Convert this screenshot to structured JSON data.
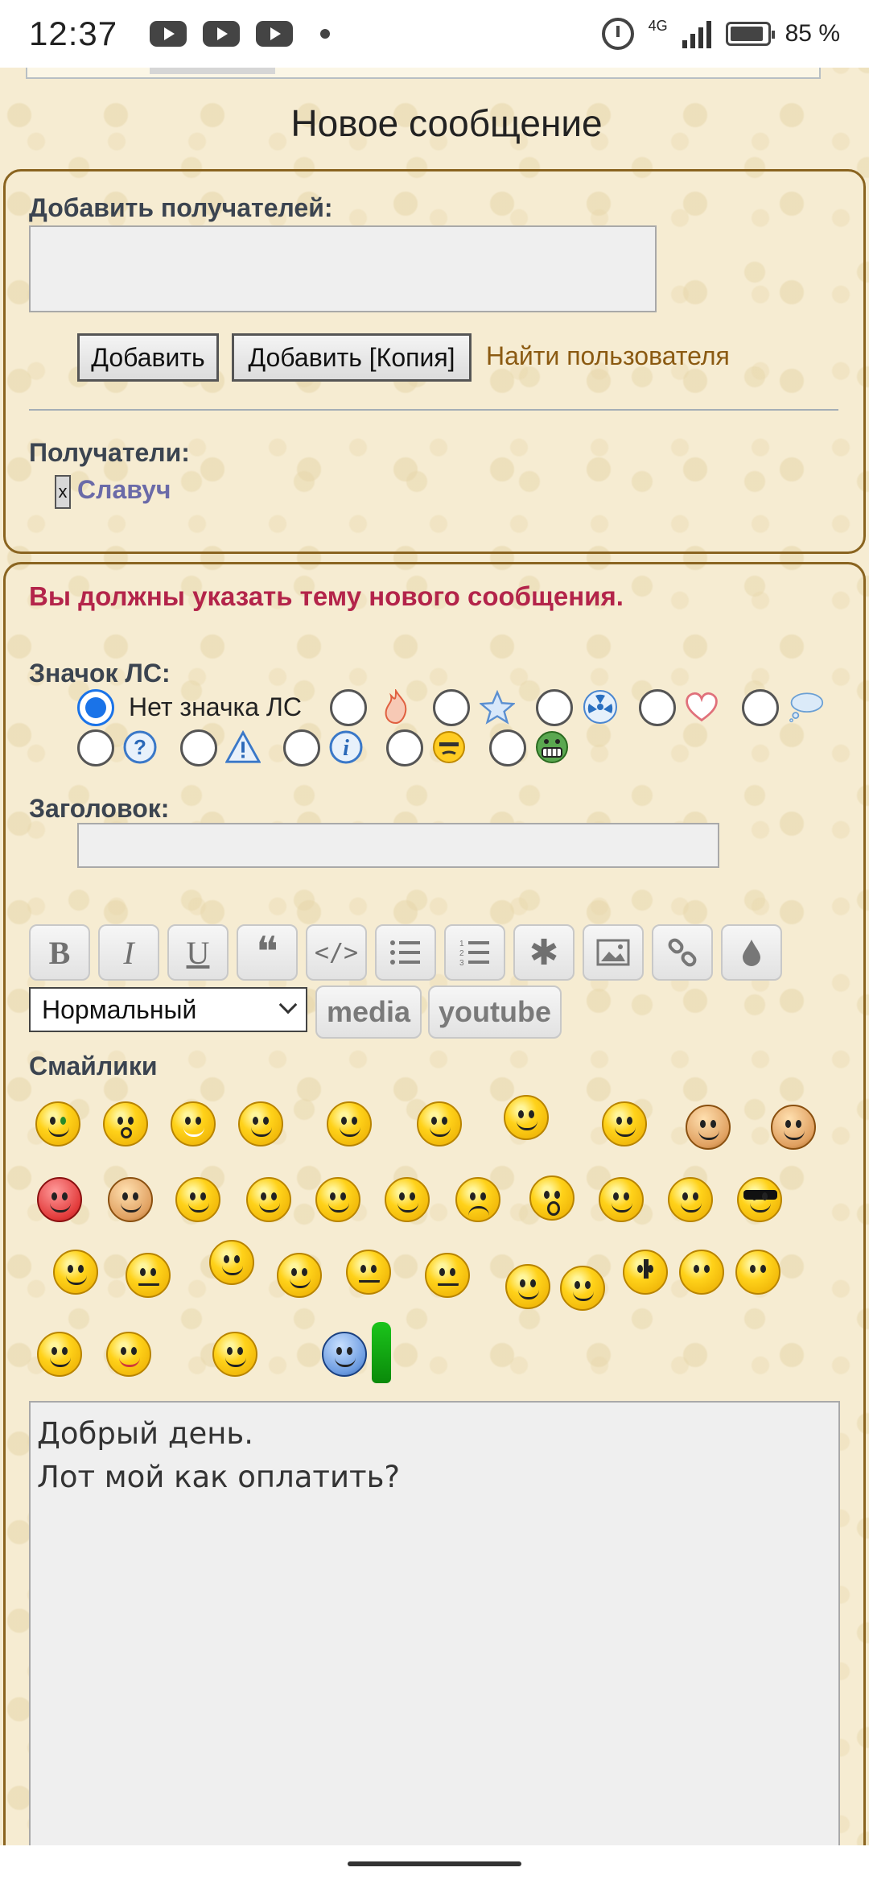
{
  "status_bar": {
    "time": "12:37",
    "network": "4G",
    "battery": "85 %",
    "notification_icons": [
      "youtube-icon",
      "youtube-icon",
      "youtube-icon"
    ]
  },
  "page": {
    "title": "Новое сообщение"
  },
  "recipients_box": {
    "add_label": "Добавить получателей:",
    "add_input_value": "",
    "add_button": "Добавить",
    "add_copy_button": "Добавить [Копия]",
    "find_user_link": "Найти пользователя",
    "recipients_label": "Получатели:",
    "remove_symbol": "x",
    "recipients": [
      "Славуч"
    ]
  },
  "message_box": {
    "error": "Вы должны указать тему нового сообщения.",
    "pm_icon_label": "Значок ЛС:",
    "pm_icon_options": [
      {
        "name": "no-icon",
        "label": "Нет значка ЛС",
        "selected": true
      },
      {
        "name": "fire-icon",
        "label": "",
        "selected": false
      },
      {
        "name": "star-icon",
        "label": "",
        "selected": false
      },
      {
        "name": "radiation-icon",
        "label": "",
        "selected": false
      },
      {
        "name": "heart-icon",
        "label": "",
        "selected": false
      },
      {
        "name": "speech-bubble-icon",
        "label": "",
        "selected": false
      },
      {
        "name": "question-icon",
        "label": "",
        "selected": false
      },
      {
        "name": "warning-icon",
        "label": "",
        "selected": false
      },
      {
        "name": "info-icon",
        "label": "",
        "selected": false
      },
      {
        "name": "shy-smiley-icon",
        "label": "",
        "selected": false
      },
      {
        "name": "grin-smiley-icon",
        "label": "",
        "selected": false
      }
    ],
    "subject_label": "Заголовок:",
    "subject_value": "",
    "toolbar": {
      "buttons": [
        "bold",
        "italic",
        "underline",
        "quote",
        "code",
        "bullet-list",
        "numbered-list",
        "asterisk",
        "image",
        "link",
        "color"
      ],
      "bold_glyph": "B",
      "italic_glyph": "I",
      "underline_glyph": "U",
      "quote_glyph": "❝",
      "code_glyph": "</>",
      "asterisk_glyph": "✱",
      "size_select": "Нормальный",
      "media_button": "media",
      "youtube_button": "youtube"
    },
    "smilies_label": "Смайлики",
    "smilies_count": 34,
    "message_text": "Добрый день.\nЛот мой как оплатить?"
  },
  "colors": {
    "background": "#f6ecd2",
    "border_brown": "#8a6420",
    "error_red": "#b3244a",
    "link_brown": "#8b5a12",
    "recipient_purple": "#6a6aa8",
    "radio_blue": "#1a73e8"
  }
}
